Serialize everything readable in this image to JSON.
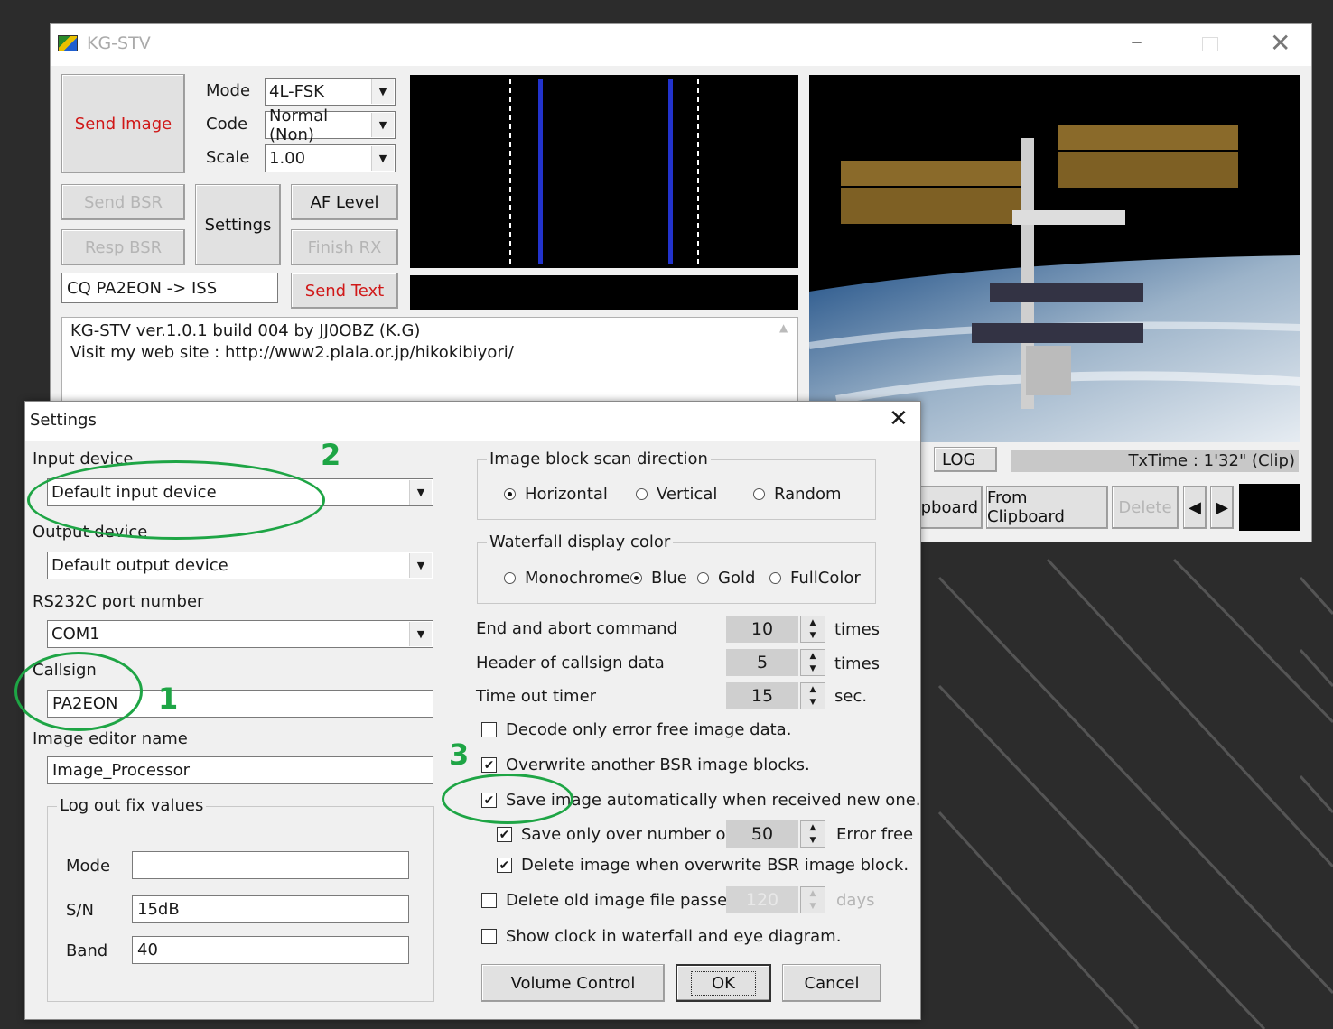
{
  "main_window": {
    "title": "KG-STV",
    "send_image": "Send Image",
    "mode_label": "Mode",
    "mode_value": "4L-FSK",
    "code_label": "Code",
    "code_value": "Normal (Non)",
    "scale_label": "Scale",
    "scale_value": "1.00",
    "send_bsr": "Send BSR",
    "resp_bsr": "Resp BSR",
    "settings": "Settings",
    "af_level": "AF Level",
    "finish_rx": "Finish RX",
    "cq_text": "CQ PA2EON -> ISS",
    "send_text": "Send Text",
    "log_line1": "KG-STV ver.1.0.1 build 004  by JJ0OBZ (K.G)",
    "log_line2": "Visit my web site : http://www2.plala.or.jp/hikokibiyori/",
    "log_tab": "LOG",
    "txtime": "TxTime : 1'32\" (Clip)",
    "clipboard_partial": "ipboard",
    "from_clipboard": "From Clipboard",
    "delete": "Delete"
  },
  "dialog": {
    "title": "Settings",
    "input_device_label": "Input device",
    "input_device_value": "Default input device",
    "output_device_label": "Output device",
    "output_device_value": "Default output device",
    "rs232_label": "RS232C port number",
    "rs232_value": "COM1",
    "callsign_label": "Callsign",
    "callsign_value": "PA2EON",
    "image_editor_label": "Image editor name",
    "image_editor_value": "Image_Processor",
    "logout_group": "Log out fix values",
    "log_mode_label": "Mode",
    "log_mode_value": "",
    "log_sn_label": "S/N",
    "log_sn_value": "15dB",
    "log_band_label": "Band",
    "log_band_value": "40",
    "scan_group": "Image block scan direction",
    "scan_options": [
      "Horizontal",
      "Vertical",
      "Random"
    ],
    "waterfall_group": "Waterfall display color",
    "waterfall_options": [
      "Monochrome",
      "Blue",
      "Gold",
      "FullColor"
    ],
    "end_abort_label": "End and abort command",
    "end_abort_value": "10",
    "end_abort_unit": "times",
    "header_label": "Header of callsign data",
    "header_value": "5",
    "header_unit": "times",
    "timeout_label": "Time out timer",
    "timeout_value": "15",
    "timeout_unit": "sec.",
    "chk_decode": "Decode only error free image data.",
    "chk_overwrite": "Overwrite another BSR image blocks.",
    "chk_save_auto": "Save image automatically when received new one.",
    "chk_save_over": "Save only over number of",
    "save_over_value": "50",
    "save_over_unit": "Error free",
    "chk_delete_overwrite": "Delete image when overwrite BSR image block.",
    "chk_delete_old": "Delete old image file passed",
    "delete_old_value": "120",
    "delete_old_unit": "days",
    "chk_clock": "Show clock in waterfall and eye diagram.",
    "volume_control": "Volume Control",
    "ok": "OK",
    "cancel": "Cancel"
  },
  "annotations": {
    "n1": "1",
    "n2": "2",
    "n3": "3"
  },
  "colors": {
    "accent_red": "#d01818",
    "annotation_green": "#1ea545",
    "waterfall_blue": "#2233cc"
  }
}
